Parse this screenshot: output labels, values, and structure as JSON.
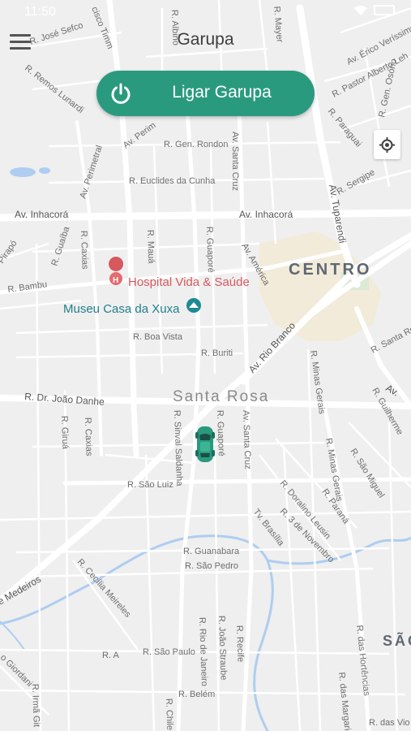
{
  "status": {
    "time": "11:50"
  },
  "header": {
    "title": "Garupa"
  },
  "action": {
    "label": "Ligar Garupa"
  },
  "colors": {
    "accent": "#2a9a7f",
    "poi_red": "#d6595e",
    "poi_teal": "#1f7f8c"
  },
  "map": {
    "neighborhoods": {
      "centro": "CENTRO",
      "santa_rosa": "Santa Rosa",
      "sao": "SÃO"
    },
    "pois": {
      "hospital": "Hospital Vida & Saúde",
      "museum": "Museu Casa da Xuxa"
    },
    "streets": {
      "jose": "R. José Sefco",
      "timm": "cisco Timm",
      "albino": "R. Albino",
      "remos": "R. Remos Lunardi",
      "mayer": "R. Mayer",
      "erico": "Av. Érico Veríssimo",
      "pastor": "R. Pastor Alberto Leh",
      "osorio": "R. Gen. Osório",
      "paraguai": "R. Paraguai",
      "perimetral": "Av. Perimetral",
      "perim2": "Av. Perim",
      "rondon": "R. Gen. Rondon",
      "euclides": "R. Euclides da Cunha",
      "santa_cruz": "Av. Santa Cruz",
      "sergipe": "R. Sergipe",
      "tuparendi": "Av. Tuparendi",
      "inhacora1": "Av. Inhacorá",
      "inhacora2": "Av. Inhacorá",
      "guaiba": "R. Guaíba",
      "caxias": "R. Caxias",
      "maua": "R. Mauá",
      "guapore": "R. Guaporé",
      "america": "Av. América",
      "pirapo": "Pirapó",
      "bambu": "R. Bambu",
      "boa_vista": "R. Boa Vista",
      "buriti": "R. Buriti",
      "rio_branco": "Av. Rio Branco",
      "minas1": "R. Minas Gerais",
      "santa_ro": "R. Santa Ro",
      "joao_danhe": "R. Dr. João Danhe",
      "girua": "R. Giruá",
      "caxias2": "R. Caxias",
      "sinval": "R. Sinval Saldanha",
      "guapore2": "R. Guaporé",
      "santa_cruz2": "Av. Santa Cruz",
      "guilherme": "R. Guilherme",
      "sao_miguel": "R. São Miguel",
      "minas2": "R. Minas Gerais",
      "parana": "R. Paraná",
      "sao_luiz": "R. São Luiz",
      "doralino": "R. Doralino Leusin",
      "novembro": "R. 3 de Novembro",
      "brasilia": "Tv. Brasília",
      "guanabara": "R. Guanabara",
      "sao_pedro": "R. São Pedro",
      "medeiros": "e Medeiros",
      "cecilia": "R. Cecília Meireles",
      "rio_jan": "R. Rio de Janeiro",
      "joao_str": "R. João Straube",
      "recife": "R. Recife",
      "hortencias": "R. das Hortências",
      "margaridas": "R. das Margaridas",
      "r_a": "R. A",
      "sao_paulo": "R. São Paulo",
      "giordani": "o Giordani",
      "irma": "R. Irmã Git",
      "belem": "R. Belém",
      "chile": "R. Chile",
      "violetas": "R. das Vio",
      "av": "Av."
    }
  }
}
